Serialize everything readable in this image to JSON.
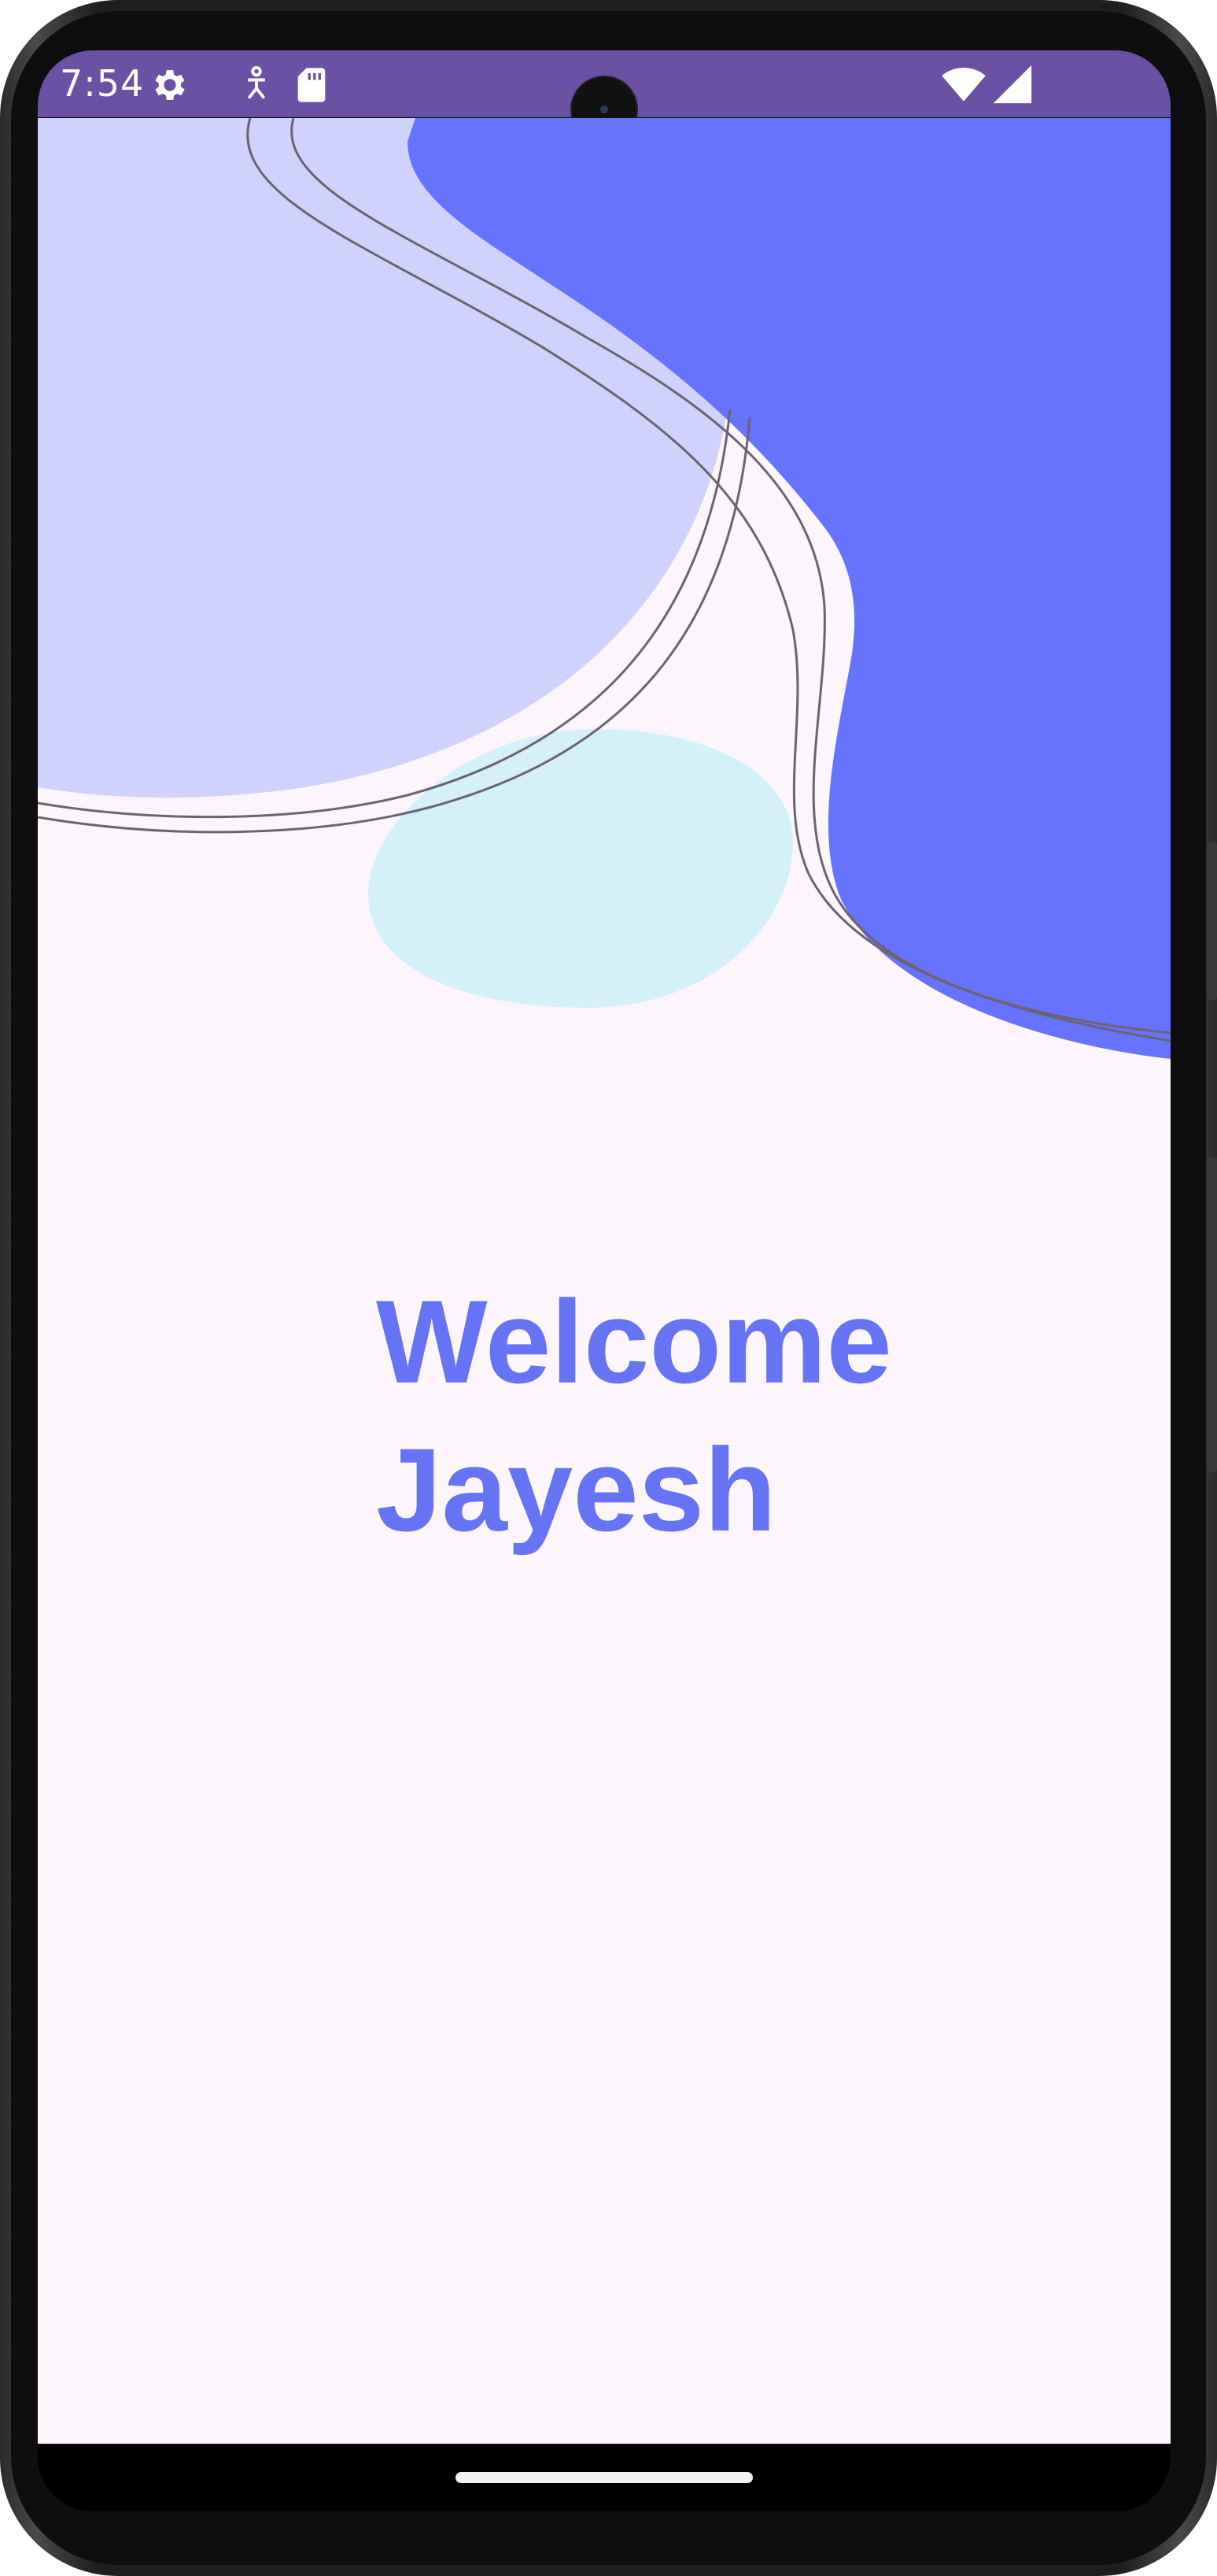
{
  "status_bar": {
    "time": "7:54",
    "background_color": "#6a51a3",
    "left_icons": [
      "settings-gear-icon",
      "accessibility-person-icon",
      "sd-card-icon"
    ],
    "right_icons": [
      "wifi-icon",
      "cell-signal-icon"
    ]
  },
  "main": {
    "greeting_line1": "Welcome",
    "greeting_line2": "Jayesh",
    "text_color": "#6673f5",
    "background_color": "#fcf5fc",
    "decor_colors": {
      "blob_light_purple": "#cfd2fe",
      "blob_blue": "#6673ff",
      "blob_light_cyan": "#d4f0f8",
      "outline_lines": "#6b6470"
    }
  },
  "nav_bar": {
    "handle": "home-gesture-handle"
  }
}
